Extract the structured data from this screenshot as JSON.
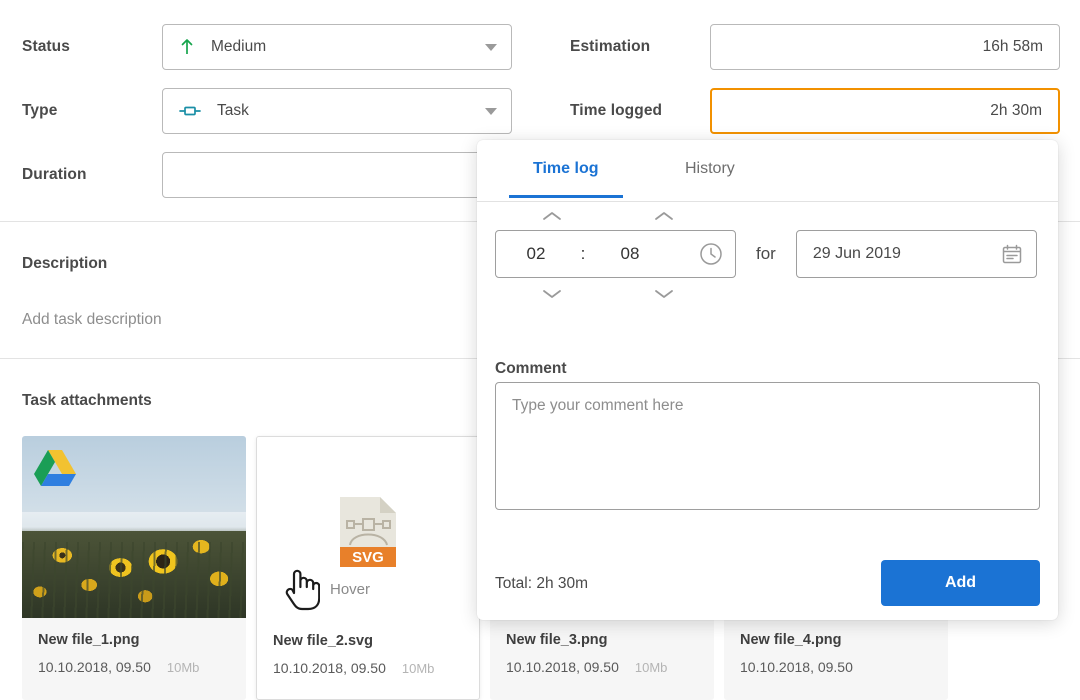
{
  "form": {
    "rows": [
      {
        "label": "Status",
        "value": "Medium",
        "icon": "arrow-up-icon",
        "type": "select"
      },
      {
        "label": "Type",
        "value": "Task",
        "icon": "task-bar-icon",
        "type": "select"
      },
      {
        "label": "Duration",
        "value": "",
        "icon": "",
        "type": "input"
      }
    ],
    "rows_right": [
      {
        "label": "Estimation",
        "value": "16h 58m",
        "state": "normal"
      },
      {
        "label": "Time logged",
        "value": "2h 30m",
        "state": "focused"
      }
    ]
  },
  "description": {
    "title": "Description",
    "placeholder": "Add task description"
  },
  "attachments": {
    "title": "Task attachments",
    "items": [
      {
        "name": "New file_1.png",
        "date": "10.10.2018, 09.50",
        "size": "10Mb",
        "thumb": "photo",
        "badge": "gdrive-icon",
        "hovered": false,
        "hover_label": ""
      },
      {
        "name": "New file_2.svg",
        "date": "10.10.2018, 09.50",
        "size": "10Mb",
        "thumb": "svg-file",
        "badge": "",
        "hovered": true,
        "hover_label": "Hover"
      },
      {
        "name": "New file_3.png",
        "date": "10.10.2018, 09.50",
        "size": "10Mb",
        "thumb": "photo",
        "badge": "",
        "hovered": false,
        "hover_label": ""
      },
      {
        "name": "New file_4.png",
        "date": "10.10.2018, 09.50",
        "size": "",
        "thumb": "photo",
        "badge": "",
        "hovered": false,
        "hover_label": ""
      }
    ],
    "svg_badge_text": "SVG"
  },
  "panel": {
    "tabs": [
      {
        "label": "Time log",
        "active": true
      },
      {
        "label": "History",
        "active": false
      }
    ],
    "time": {
      "hours": "02",
      "separator": ":",
      "minutes": "08"
    },
    "for_word": "for",
    "date": "29 Jun 2019",
    "comment": {
      "label": "Comment",
      "placeholder": "Type your comment here",
      "value": ""
    },
    "total": "Total: 2h 30m",
    "add_label": "Add"
  },
  "colors": {
    "accent_blue": "#1b73d4",
    "focus_orange": "#f29100",
    "priority_green": "#16a44c",
    "task_teal": "#1a8fa6",
    "svg_orange": "#e8802a",
    "text_dark": "#4a4a4a",
    "text_muted": "#8d8d8d"
  }
}
